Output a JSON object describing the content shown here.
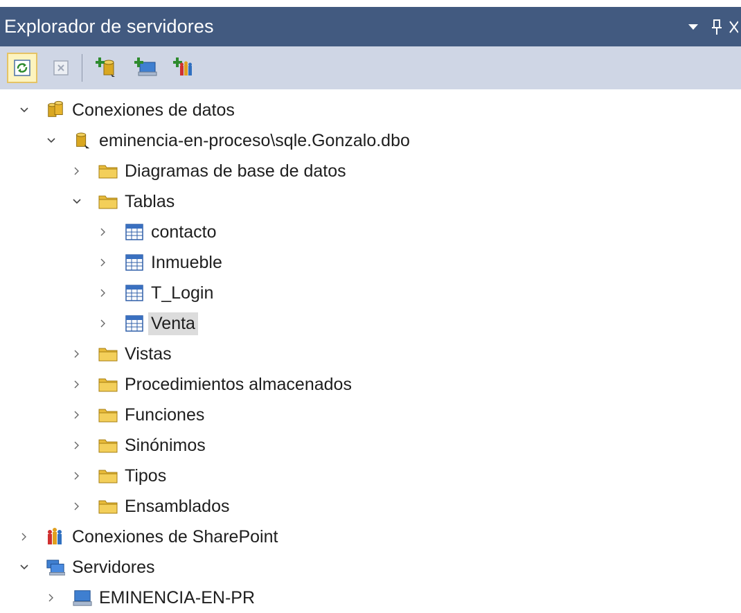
{
  "panel": {
    "title": "Explorador de servidores",
    "dropdown_icon": "chevron-down-icon",
    "pin_icon": "pin-icon",
    "close_icon": "close-icon"
  },
  "toolbar": {
    "buttons": [
      {
        "name": "refresh-button",
        "icon": "refresh-icon",
        "active": true
      },
      {
        "name": "stop-button",
        "icon": "stop-icon",
        "active": false
      },
      {
        "name": "connect-database-button",
        "icon": "connect-database-icon",
        "active": false
      },
      {
        "name": "connect-server-button",
        "icon": "connect-server-icon",
        "active": false
      },
      {
        "name": "connect-sharepoint-button",
        "icon": "connect-sharepoint-icon",
        "active": false
      }
    ]
  },
  "tree": {
    "nodes": [
      {
        "label": "Conexiones de datos",
        "level": 0,
        "expanded": true,
        "icon": "data-connections-icon"
      },
      {
        "label": "eminencia-en-proceso\\sqle.Gonzalo.dbo",
        "level": 1,
        "expanded": true,
        "icon": "database-connection-icon"
      },
      {
        "label": "Diagramas de base de datos",
        "level": 2,
        "expanded": false,
        "icon": "folder-icon"
      },
      {
        "label": "Tablas",
        "level": 2,
        "expanded": true,
        "icon": "folder-icon"
      },
      {
        "label": "contacto",
        "level": 3,
        "expanded": false,
        "icon": "table-icon"
      },
      {
        "label": "Inmueble",
        "level": 3,
        "expanded": false,
        "icon": "table-icon"
      },
      {
        "label": "T_Login",
        "level": 3,
        "expanded": false,
        "icon": "table-icon"
      },
      {
        "label": "Venta",
        "level": 3,
        "expanded": false,
        "icon": "table-icon",
        "selected": true
      },
      {
        "label": "Vistas",
        "level": 2,
        "expanded": false,
        "icon": "folder-icon"
      },
      {
        "label": "Procedimientos almacenados",
        "level": 2,
        "expanded": false,
        "icon": "folder-icon"
      },
      {
        "label": "Funciones",
        "level": 2,
        "expanded": false,
        "icon": "folder-icon"
      },
      {
        "label": "Sinónimos",
        "level": 2,
        "expanded": false,
        "icon": "folder-icon"
      },
      {
        "label": "Tipos",
        "level": 2,
        "expanded": false,
        "icon": "folder-icon"
      },
      {
        "label": "Ensamblados",
        "level": 2,
        "expanded": false,
        "icon": "folder-icon"
      },
      {
        "label": "Conexiones de SharePoint",
        "level": 0,
        "expanded": false,
        "icon": "sharepoint-icon"
      },
      {
        "label": "Servidores",
        "level": 0,
        "expanded": true,
        "icon": "servers-icon"
      },
      {
        "label": "EMINENCIA-EN-PR",
        "level": 1,
        "expanded": false,
        "icon": "computer-icon"
      }
    ]
  }
}
